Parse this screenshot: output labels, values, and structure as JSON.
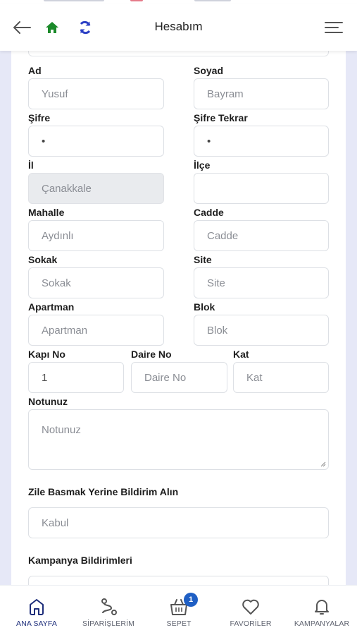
{
  "header": {
    "title": "Hesabım",
    "back_icon": "arrow-left-icon",
    "home_icon": "home-icon",
    "refresh_icon": "refresh-icon",
    "menu_icon": "menu-icon"
  },
  "colors": {
    "home_green": "#1b8a2a",
    "refresh_blue": "#2b3fc4",
    "nav_active": "#1d2d7a",
    "badge_blue": "#1f5fc4",
    "page_bg": "#e6e8f7"
  },
  "form": {
    "ad": {
      "label": "Ad",
      "placeholder": "Yusuf"
    },
    "soyad": {
      "label": "Soyad",
      "placeholder": "Bayram"
    },
    "sifre": {
      "label": "Şifre",
      "value": "•"
    },
    "sifre_tekrar": {
      "label": "Şifre Tekrar",
      "value": "•"
    },
    "il": {
      "label": "İl",
      "value": "Çanakkale"
    },
    "ilce": {
      "label": "İlçe",
      "value": ""
    },
    "mahalle": {
      "label": "Mahalle",
      "placeholder": "Aydınlı"
    },
    "cadde": {
      "label": "Cadde",
      "placeholder": "Cadde"
    },
    "sokak": {
      "label": "Sokak",
      "placeholder": "Sokak"
    },
    "site": {
      "label": "Site",
      "placeholder": "Site"
    },
    "apartman": {
      "label": "Apartman",
      "placeholder": "Apartman"
    },
    "blok": {
      "label": "Blok",
      "placeholder": "Blok"
    },
    "kapi_no": {
      "label": "Kapı No",
      "value": "1"
    },
    "daire_no": {
      "label": "Daire No",
      "placeholder": "Daire No"
    },
    "kat": {
      "label": "Kat",
      "placeholder": "Kat"
    },
    "notunuz": {
      "label": "Notunuz",
      "placeholder": "Notunuz"
    },
    "zile_basmak": {
      "label": "Zile Basmak Yerine Bildirim Alın",
      "value": "Kabul"
    },
    "kampanya": {
      "label": "Kampanya Bildirimleri"
    }
  },
  "bottom_nav": {
    "items": [
      {
        "label": "ANA SAYFA",
        "icon": "home-outline-icon",
        "active": true
      },
      {
        "label": "SİPARİŞLERİM",
        "icon": "route-icon",
        "active": false
      },
      {
        "label": "SEPET",
        "icon": "basket-icon",
        "active": false,
        "badge": "1"
      },
      {
        "label": "FAVORİLER",
        "icon": "heart-icon",
        "active": false
      },
      {
        "label": "KAMPANYALAR",
        "icon": "bell-icon",
        "active": false
      }
    ]
  }
}
